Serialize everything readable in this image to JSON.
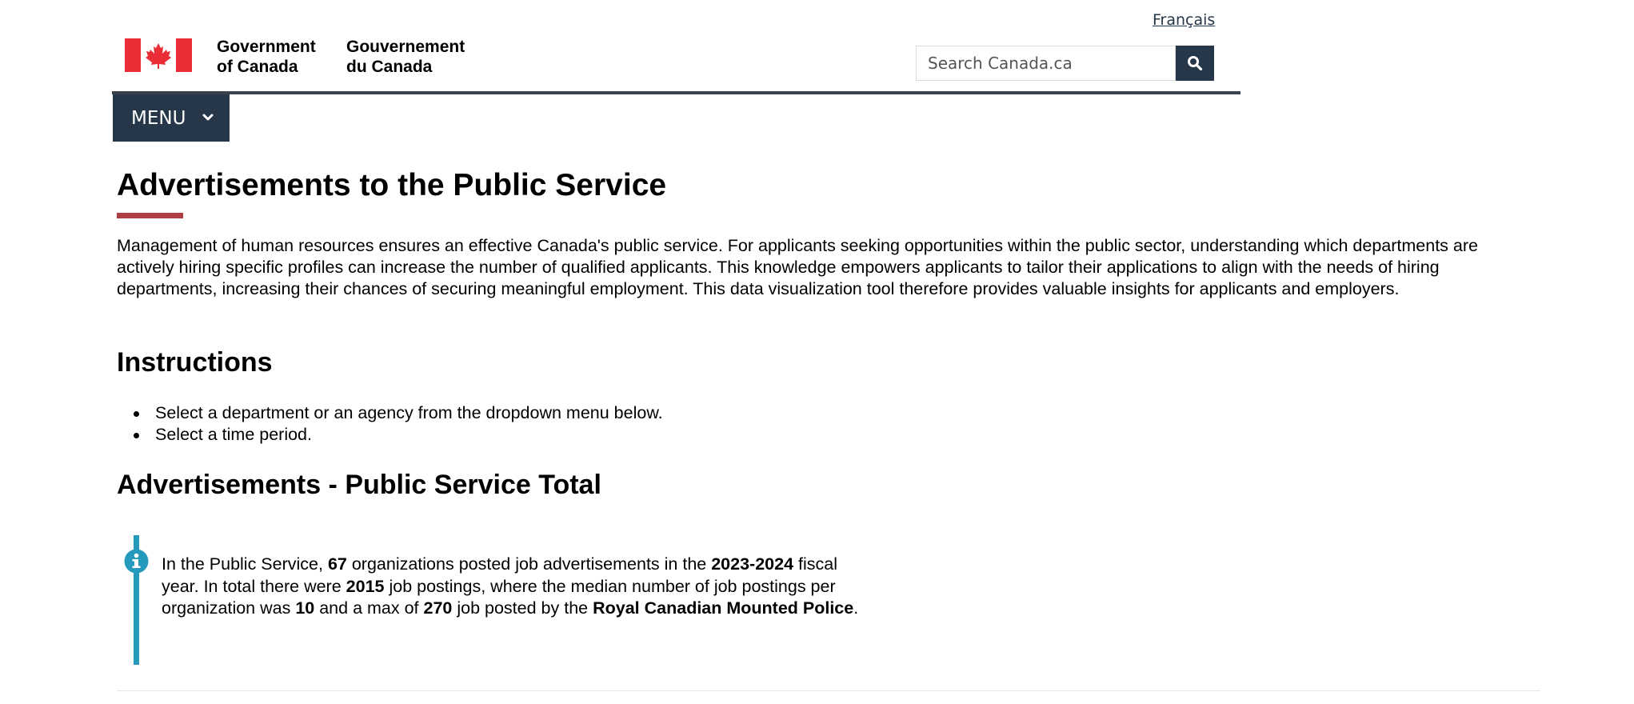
{
  "header": {
    "language_link": "Français",
    "signature_en": [
      "Government",
      "of Canada"
    ],
    "signature_fr": [
      "Gouvernement",
      "du Canada"
    ],
    "search_placeholder": "Search Canada.ca",
    "search_icon": "search-icon",
    "flag_color": "#eb2d37"
  },
  "menu": {
    "label": "MENU",
    "icon": "chevron-down-icon"
  },
  "page": {
    "title": "Advertisements to the Public Service",
    "title_underline_color": "#af3c43",
    "intro": "Management of human resources ensures an effective Canada's public service. For applicants seeking opportunities within the public sector, understanding which departments are actively hiring specific profiles can increase the number of qualified applicants. This knowledge empowers applicants to tailor their applications to align with the needs of hiring departments, increasing their chances of securing meaningful employment. This data visualization tool therefore provides valuable insights for applicants and employers."
  },
  "instructions": {
    "heading": "Instructions",
    "items": [
      "Select a department or an agency from the dropdown menu below.",
      "Select a time period."
    ]
  },
  "total": {
    "heading": "Advertisements - Public Service Total",
    "alert_icon": "info-icon",
    "alert_color": "#269abc",
    "alert": {
      "t1": "In the Public Service, ",
      "org_count": "67",
      "t2": " organizations posted job advertisements in the ",
      "fiscal_year": "2023-2024",
      "t3": " fiscal year. In total there were ",
      "total_postings": "2015",
      "t4": " job postings, where the median number of job postings per organization was ",
      "median": "10",
      "t5": " and a max of ",
      "max": "270",
      "t6": " job posted by the ",
      "top_org": "Royal Canadian Mounted Police",
      "t7": "."
    }
  }
}
